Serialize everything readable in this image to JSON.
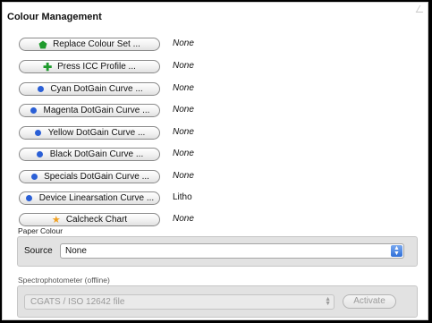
{
  "title": "Colour Management",
  "buttons": [
    {
      "label": "Replace Colour Set ...",
      "value": "None",
      "icon": "pentagon-icon",
      "italic": true
    },
    {
      "label": "Press ICC Profile ...",
      "value": "None",
      "icon": "plus-icon",
      "italic": true
    },
    {
      "label": "Cyan DotGain Curve ...",
      "value": "None",
      "icon": "dot-icon",
      "italic": true
    },
    {
      "label": "Magenta DotGain Curve ...",
      "value": "None",
      "icon": "dot-icon",
      "italic": true
    },
    {
      "label": "Yellow DotGain Curve ...",
      "value": "None",
      "icon": "dot-icon",
      "italic": true
    },
    {
      "label": "Black DotGain Curve ...",
      "value": "None",
      "icon": "dot-icon",
      "italic": true
    },
    {
      "label": "Specials DotGain Curve ...",
      "value": "None",
      "icon": "dot-icon",
      "italic": true
    },
    {
      "label": "Device Linearsation Curve ...",
      "value": "Litho",
      "icon": "dot-icon",
      "italic": false
    },
    {
      "label": "Calcheck Chart",
      "value": "None",
      "icon": "star-icon",
      "italic": true
    }
  ],
  "paper_colour": {
    "section_label": "Paper Colour",
    "source_label": "Source",
    "source_value": "None"
  },
  "spectrophotometer": {
    "section_label": "Spectrophotometer (offline)",
    "select_value": "CGATS / ISO 12642 file",
    "activate_label": "Activate"
  },
  "colors": {
    "dot": "#2a5fd6",
    "pentagon": "#1e9a2c",
    "plus": "#1e9a2c",
    "star": "#f0a020"
  }
}
